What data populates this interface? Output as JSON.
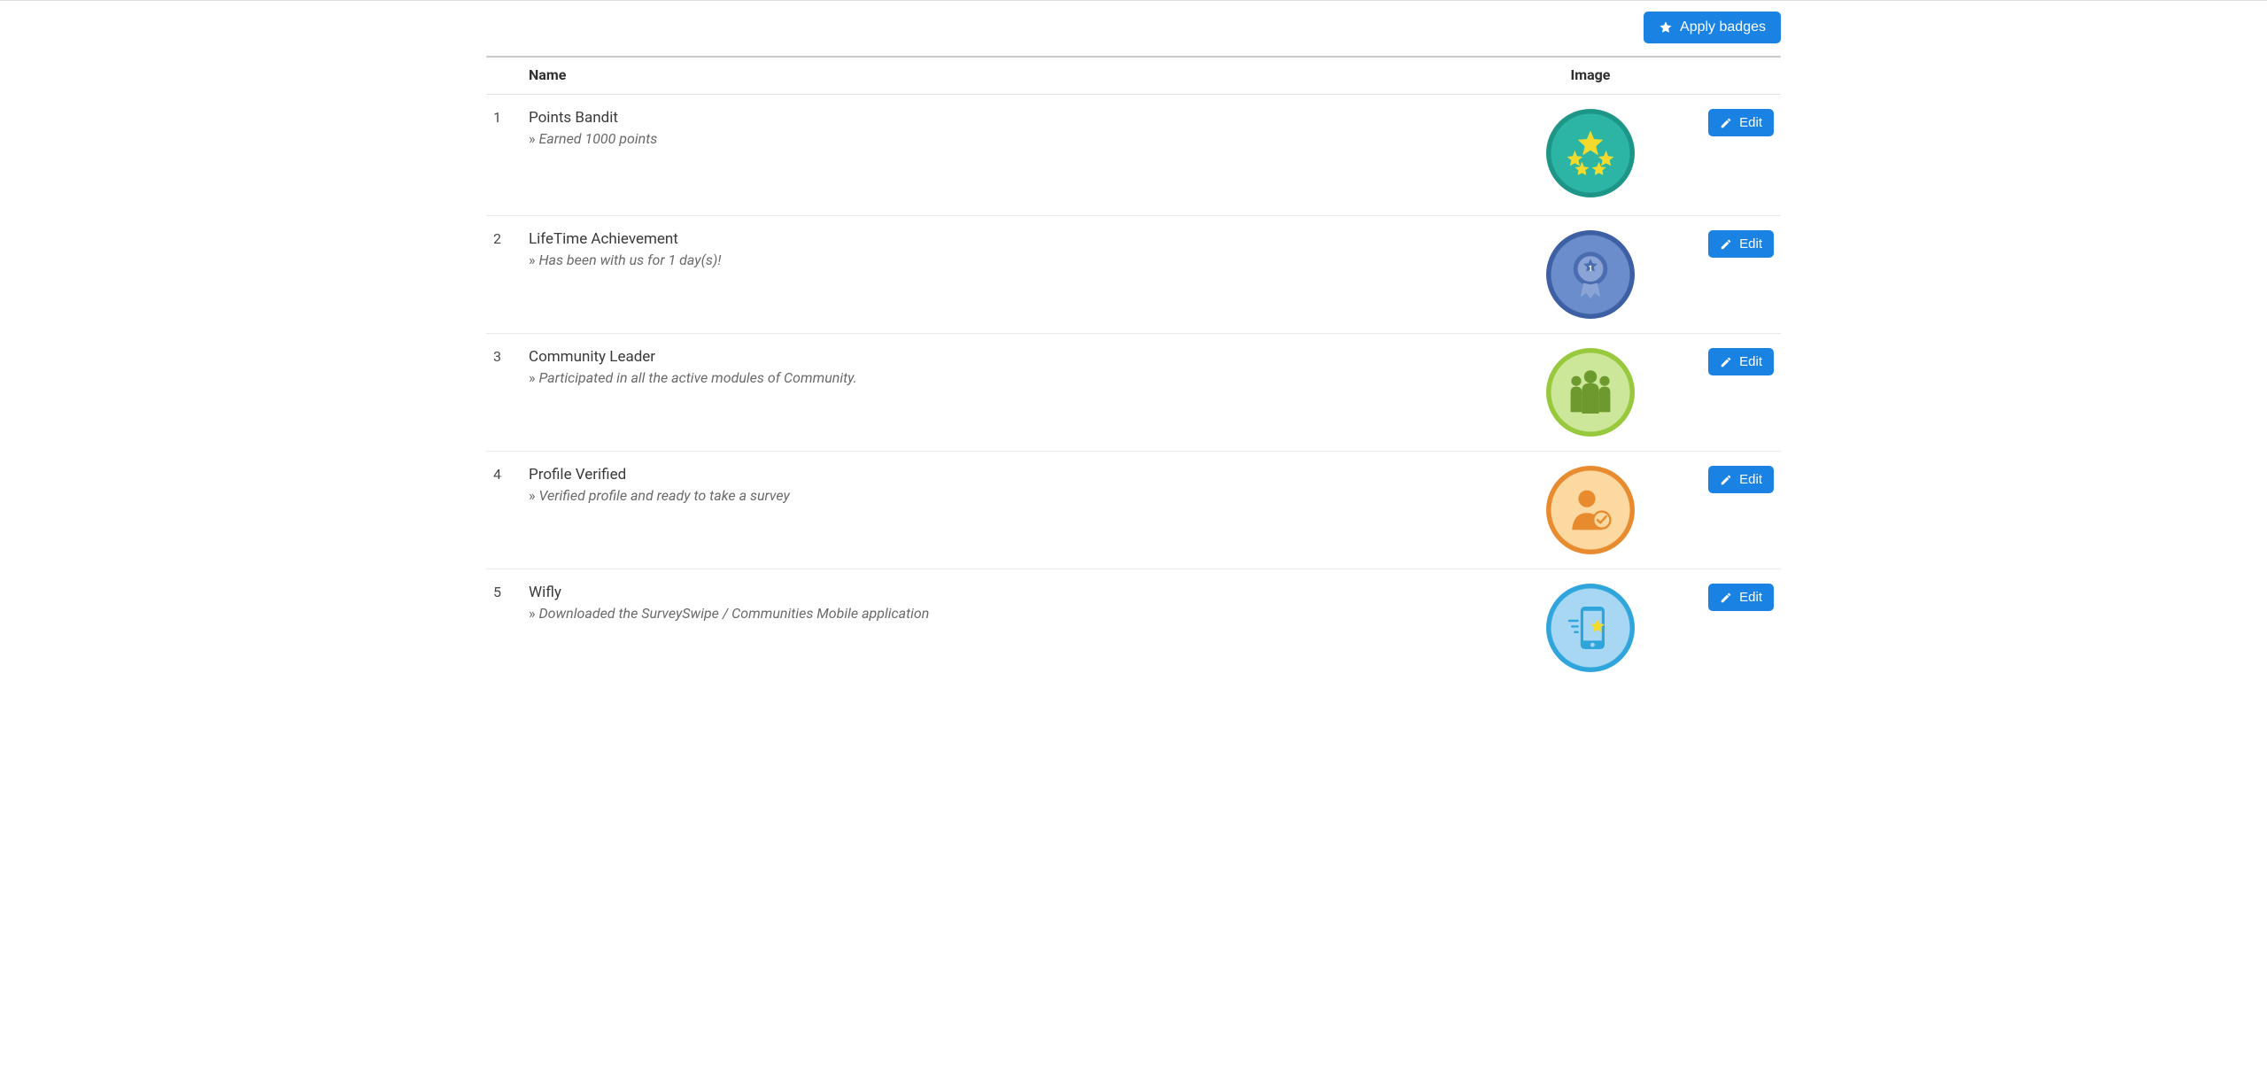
{
  "actions": {
    "apply_badges_label": "Apply badges",
    "edit_label": "Edit"
  },
  "table": {
    "headers": {
      "name": "Name",
      "image": "Image"
    },
    "rows": [
      {
        "num": "1",
        "title": "Points Bandit",
        "desc": "Earned 1000 points",
        "badge_class": "badge-1",
        "icon_name": "stars-badge-icon"
      },
      {
        "num": "2",
        "title": "LifeTime Achievement",
        "desc": "Has been with us for 1 day(s)!",
        "badge_class": "badge-2",
        "icon_name": "ribbon-badge-icon"
      },
      {
        "num": "3",
        "title": "Community Leader",
        "desc": "Participated in all the active modules of Community.",
        "badge_class": "badge-3",
        "icon_name": "people-badge-icon"
      },
      {
        "num": "4",
        "title": "Profile Verified",
        "desc": "Verified profile and ready to take a survey",
        "badge_class": "badge-4",
        "icon_name": "verified-user-badge-icon"
      },
      {
        "num": "5",
        "title": "Wifly",
        "desc": "Downloaded the SurveySwipe / Communities Mobile application",
        "badge_class": "badge-5",
        "icon_name": "mobile-badge-icon"
      }
    ]
  }
}
